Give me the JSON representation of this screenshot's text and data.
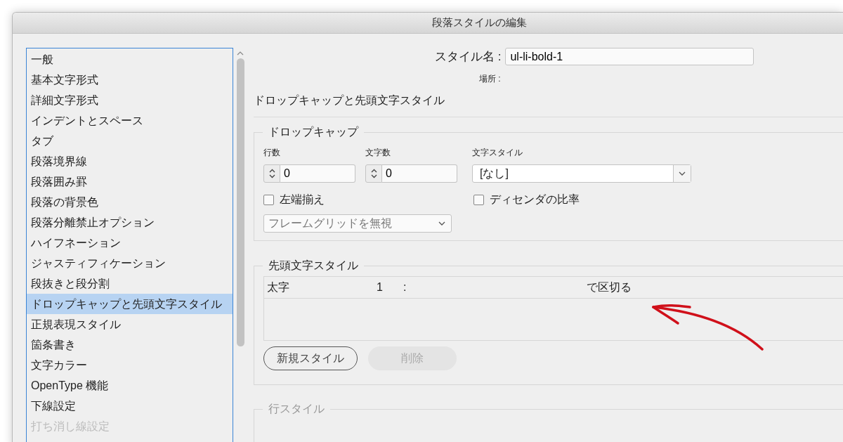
{
  "window": {
    "title": "段落スタイルの編集"
  },
  "sidebar": {
    "items": [
      {
        "label": "一般",
        "selected": false
      },
      {
        "label": "基本文字形式",
        "selected": false
      },
      {
        "label": "詳細文字形式",
        "selected": false
      },
      {
        "label": "インデントとスペース",
        "selected": false
      },
      {
        "label": "タブ",
        "selected": false
      },
      {
        "label": "段落境界線",
        "selected": false
      },
      {
        "label": "段落囲み罫",
        "selected": false
      },
      {
        "label": "段落の背景色",
        "selected": false
      },
      {
        "label": "段落分離禁止オプション",
        "selected": false
      },
      {
        "label": "ハイフネーション",
        "selected": false
      },
      {
        "label": "ジャスティフィケーション",
        "selected": false
      },
      {
        "label": "段抜きと段分割",
        "selected": false
      },
      {
        "label": "ドロップキャップと先頭文字スタイル",
        "selected": true
      },
      {
        "label": "正規表現スタイル",
        "selected": false
      },
      {
        "label": "箇条書き",
        "selected": false
      },
      {
        "label": "文字カラー",
        "selected": false
      },
      {
        "label": "OpenType 機能",
        "selected": false
      },
      {
        "label": "下線設定",
        "selected": false
      },
      {
        "label": "打ち消し線設定",
        "selected": false
      }
    ]
  },
  "style_name": {
    "label": "スタイル名 :",
    "value": "ul-li-bold-1"
  },
  "location": {
    "label": "場所 :"
  },
  "section_title": "ドロップキャップと先頭文字スタイル",
  "drop_cap": {
    "title": "ドロップキャップ",
    "lines": {
      "label": "行数",
      "value": "0"
    },
    "characters": {
      "label": "文字数",
      "value": "0"
    },
    "character_style": {
      "label": "文字スタイル",
      "value": "[なし]"
    },
    "align_left": {
      "label": "左端揃え",
      "checked": false
    },
    "scale_descenders": {
      "label": "ディセンダの比率",
      "checked": false
    },
    "grid": {
      "value": "フレームグリッドを無視",
      "disabled": true
    }
  },
  "nested_styles": {
    "title": "先頭文字スタイル",
    "rows": [
      {
        "cells": [
          "太字",
          "1",
          ":",
          "で区切る"
        ]
      }
    ],
    "buttons": [
      {
        "label": "新規スタイル",
        "disabled": false
      },
      {
        "label": "削除",
        "disabled": true
      }
    ]
  },
  "line_styles": {
    "title": "行スタイル"
  }
}
